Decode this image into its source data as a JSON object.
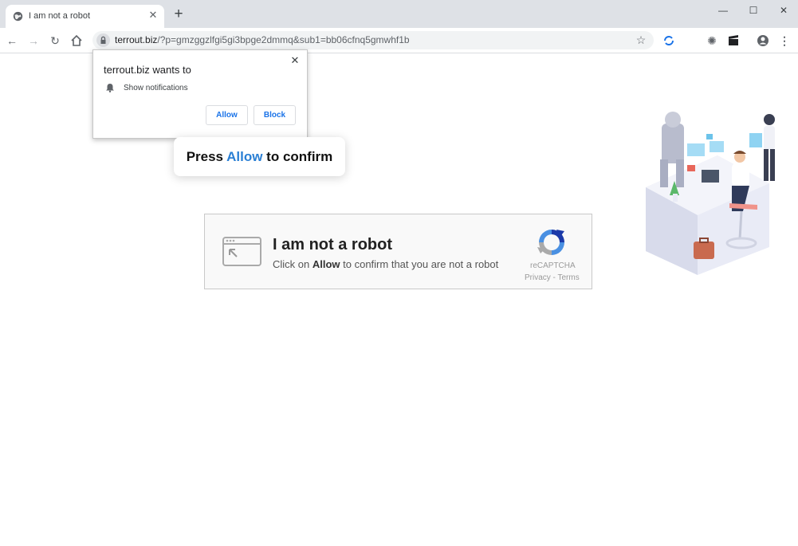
{
  "browser": {
    "tab": {
      "title": "I am not a robot",
      "favicon": "globe-icon"
    },
    "url": {
      "host": "terrout.biz",
      "path": "/?p=gmzggzlfgi5gi3bpge2dmmq&sub1=bb06cfnq5gmwhf1b"
    },
    "window_controls": [
      "minimize-icon",
      "maximize-icon",
      "close-icon"
    ]
  },
  "permission_popup": {
    "title": "terrout.biz wants to",
    "permission": "Show notifications",
    "allow_label": "Allow",
    "block_label": "Block",
    "close_glyph": "✕"
  },
  "press_allow": {
    "before": "Press ",
    "highlight": "Allow",
    "after": " to confirm",
    "highlight_color": "#2a7fd4"
  },
  "captcha": {
    "title": "I am not a robot",
    "subtitle_before": "Click on ",
    "subtitle_bold": "Allow",
    "subtitle_after": " to confirm that you are not a robot",
    "brand": "reCAPTCHA",
    "links": "Privacy - Terms"
  }
}
